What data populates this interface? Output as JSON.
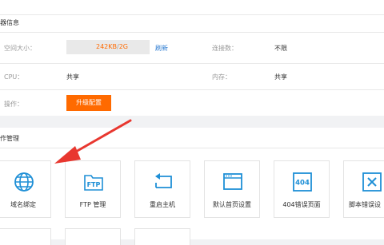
{
  "server_info": {
    "title": "器信息",
    "space_label": "空间大小：",
    "space_used": "242KB",
    "space_sep": "/",
    "space_total": "2G",
    "refresh_label": "刷新",
    "connections_label": "连接数：",
    "connections_value": "不限",
    "cpu_label": "CPU：",
    "cpu_value": "共享",
    "memory_label": "内存：",
    "memory_value": "共享",
    "operation_label": "操作：",
    "upgrade_label": "升级配置"
  },
  "operations": {
    "title": "作管理",
    "tiles": [
      {
        "label": "域名绑定",
        "icon": "globe-icon"
      },
      {
        "label": "FTP 管理",
        "icon": "ftp-folder-icon"
      },
      {
        "label": "重启主机",
        "icon": "restart-arrow-icon"
      },
      {
        "label": "默认首页设置",
        "icon": "browser-window-icon"
      },
      {
        "label": "404错误页面",
        "icon": "error-404-icon"
      },
      {
        "label": "脚本错误设",
        "icon": "close-box-icon"
      }
    ],
    "ftp_icon_text": "FTP",
    "err_icon_text": "404"
  },
  "colors": {
    "accent": "#1e8fd6",
    "orange": "#ff6a00",
    "link": "#2b7bd1",
    "arrow": "#e8372f"
  }
}
